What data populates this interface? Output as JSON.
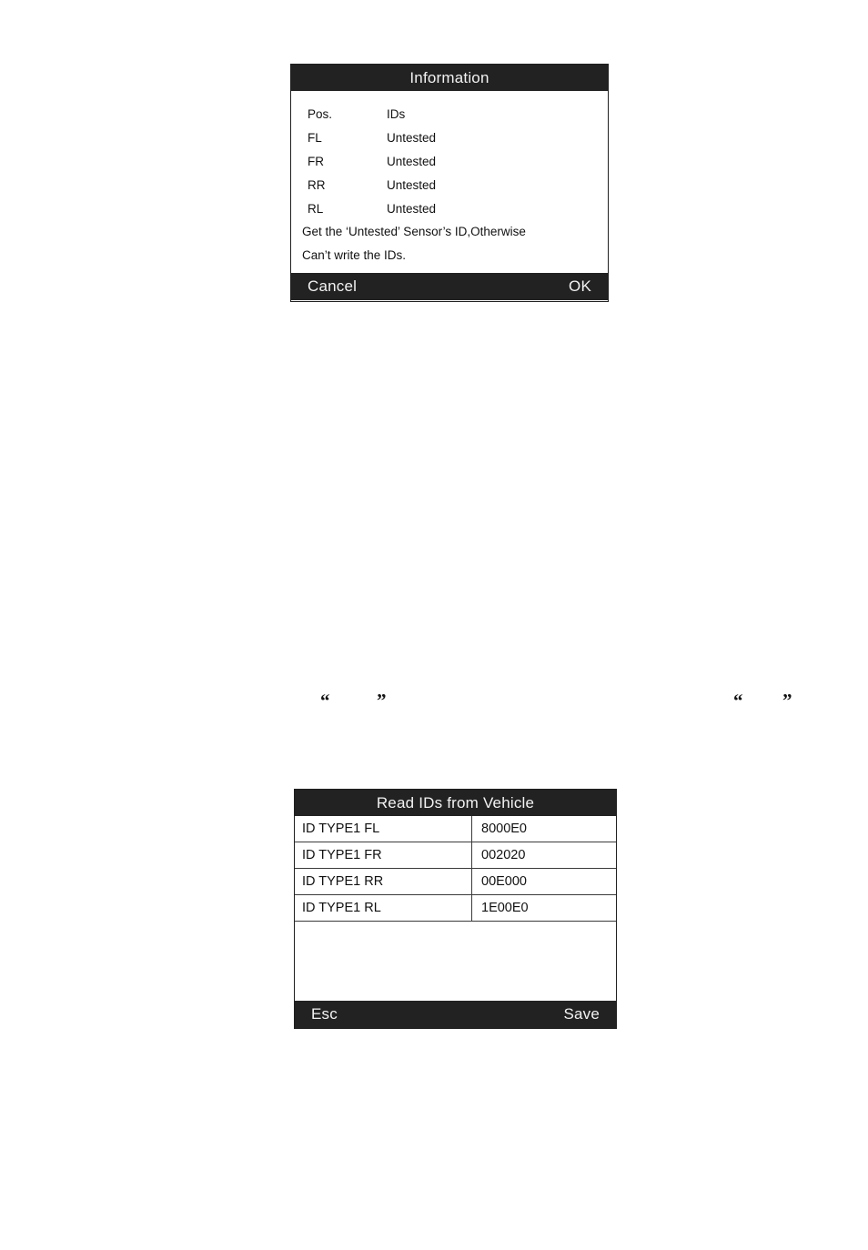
{
  "page": {
    "background_color": "#ffffff",
    "dark_ui_color": "#222222",
    "light_text_color": "#f2f2f2",
    "body_text_color": "#111111"
  },
  "information_dialog": {
    "title": "Information",
    "table_header": {
      "position": "Pos.",
      "ids": "IDs"
    },
    "rows": [
      {
        "position": "FL",
        "id": "Untested"
      },
      {
        "position": "FR",
        "id": "Untested"
      },
      {
        "position": "RR",
        "id": "Untested"
      },
      {
        "position": "RL",
        "id": "Untested"
      }
    ],
    "note_line_1": "Get the ‘Untested’ Sensor’s ID,Otherwise",
    "note_line_2": "Can’t write the IDs.",
    "footer": {
      "cancel_label": "Cancel",
      "ok_label": "OK"
    }
  },
  "read_ids_dialog": {
    "title": "Read IDs from Vehicle",
    "rows": [
      {
        "label": "ID TYPE1 FL",
        "value": "8000E0"
      },
      {
        "label": "ID TYPE1 FR",
        "value": "002020"
      },
      {
        "label": "ID TYPE1 RR",
        "value": "00E000"
      },
      {
        "label": "ID TYPE1 RL",
        "value": "1E00E0"
      }
    ],
    "footer": {
      "esc_label": "Esc",
      "save_label": "Save"
    }
  },
  "stray_marks": {
    "open_quote": "“",
    "close_quote": "”"
  }
}
